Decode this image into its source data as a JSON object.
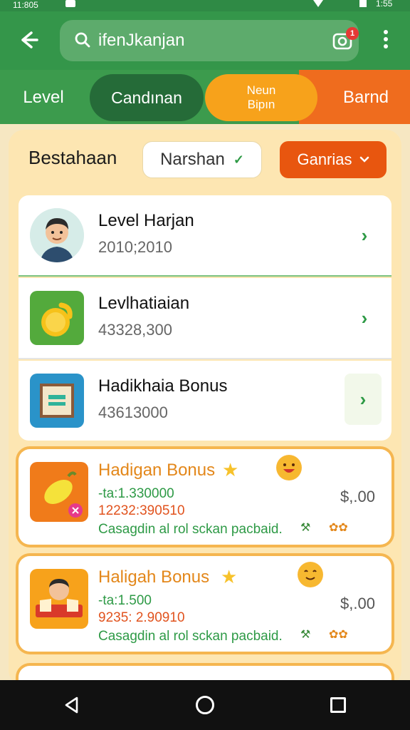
{
  "status_bar": {
    "time": "11:805",
    "time_right": "1:55"
  },
  "search": {
    "query": "ifenJkanjan",
    "camera_badge": "1"
  },
  "tabs": [
    {
      "label": "Level"
    },
    {
      "label": "Candınan"
    },
    {
      "label_line1": "Neun",
      "label_line2": "Bipın"
    },
    {
      "label": "Barnd"
    }
  ],
  "filters": {
    "title": "Bestahaan",
    "chip1": "Narshan",
    "chip2": "Ganrias"
  },
  "rows": [
    {
      "title": "Level Harjan",
      "subtitle": "2010;2010"
    },
    {
      "title": "Levlhatiaian",
      "subtitle": "43328,300"
    },
    {
      "title": "Hadikhaia Bonus",
      "subtitle": "43613000"
    }
  ],
  "bonuses": [
    {
      "title": "Hadigan Bonus",
      "line1": "-ta:1.330000",
      "line2": "12232:390510",
      "line3": "Casagdin al rol sckan pacbaid.",
      "price": "$,.00"
    },
    {
      "title": "Haligah Bonus",
      "line1": "-ta:1.500",
      "line2": "9235: 2.90910",
      "line3": "Casagdin al rol sckan pacbaid.",
      "price": "$,.00"
    }
  ],
  "colors": {
    "green": "#34964a",
    "dark_green": "#256b38",
    "orange": "#ef6c1e",
    "amber": "#f7a21b",
    "cream": "#fde6b2"
  }
}
